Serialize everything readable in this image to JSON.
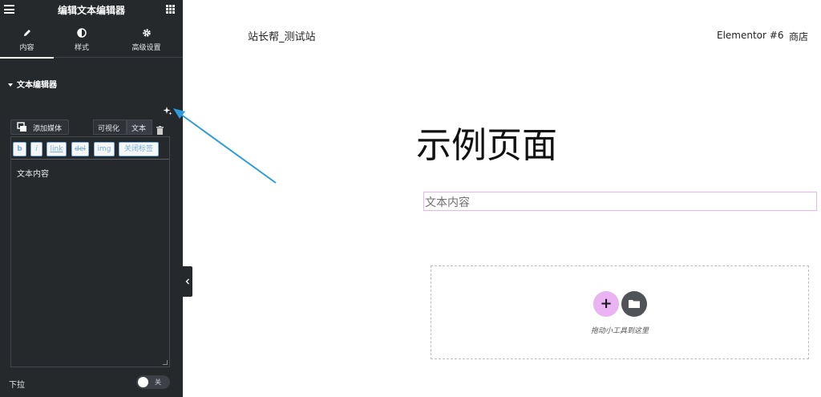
{
  "panel": {
    "title": "编辑文本编辑器",
    "tabs": [
      {
        "label": "内容",
        "icon": "pencil-icon",
        "active": true
      },
      {
        "label": "样式",
        "icon": "half-circle-icon",
        "active": false
      },
      {
        "label": "高级设置",
        "icon": "gear-icon",
        "active": false
      }
    ],
    "section_title": "文本编辑器",
    "add_media_label": "添加媒体",
    "mode_tabs": [
      "可视化",
      "文本"
    ],
    "quicktags": [
      "b",
      "i",
      "link",
      "del",
      "img",
      "关闭标签"
    ],
    "editor_content": "文本内容",
    "dropdown_label": "下拉",
    "dropdown_toggle_label": "关"
  },
  "site": {
    "name": "站长帮_测试站",
    "nav": [
      "Elementor #6",
      "商店"
    ]
  },
  "canvas": {
    "page_title": "示例页面",
    "text_widget": "文本内容",
    "drop_hint": "拖动小工具到这里"
  },
  "colors": {
    "panel_bg": "#26292c",
    "accent_pink": "#e9b4f1",
    "arrow_blue": "#2d9bdc"
  }
}
